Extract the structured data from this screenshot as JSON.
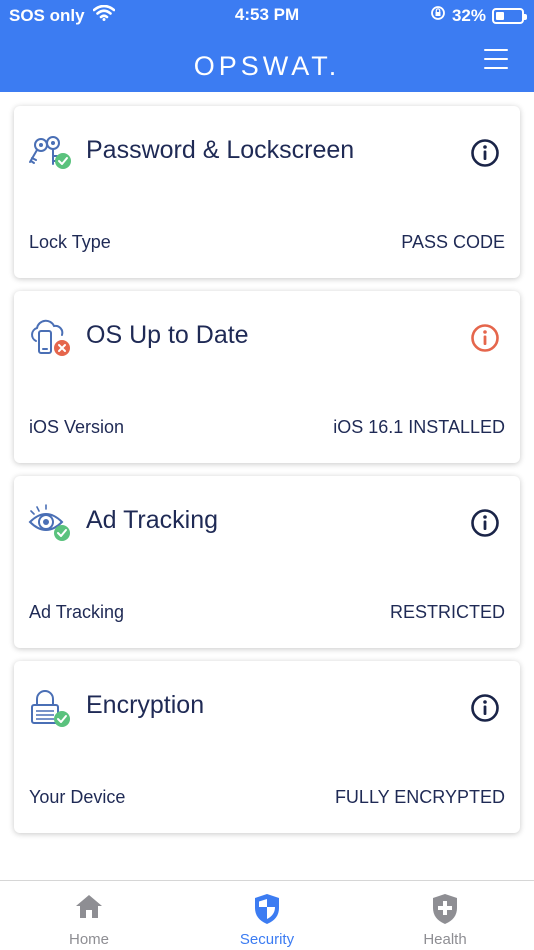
{
  "status_bar": {
    "carrier": "SOS only",
    "time": "4:53 PM",
    "battery_percent": "32%",
    "battery_level": 0.32,
    "icons": [
      "wifi-icon",
      "orientation-lock-icon",
      "battery-icon"
    ]
  },
  "nav": {
    "brand": "OPSWAT.",
    "menu_icon": "hamburger-menu-icon"
  },
  "colors": {
    "header": "#3c7cf2",
    "text": "#1f2a55",
    "ok": "#5ac27d",
    "error": "#e5664c",
    "warning_info": "#e5664c",
    "inactive_tab": "#8e8e93",
    "active_tab": "#3c7cf2"
  },
  "cards": [
    {
      "title": "Password & Lockscreen",
      "icon": "keys-icon",
      "status": "ok",
      "row_label": "Lock Type",
      "row_value": "PASS CODE"
    },
    {
      "title": "OS Up to Date",
      "icon": "cloud-phone-icon",
      "status": "error",
      "row_label": "iOS Version",
      "row_value": "iOS 16.1 INSTALLED"
    },
    {
      "title": "Ad Tracking",
      "icon": "eye-icon",
      "status": "ok",
      "row_label": "Ad Tracking",
      "row_value": "RESTRICTED"
    },
    {
      "title": "Encryption",
      "icon": "padlock-icon",
      "status": "ok",
      "row_label": "Your Device",
      "row_value": "FULLY ENCRYPTED"
    }
  ],
  "tabs": [
    {
      "label": "Home",
      "icon": "home-icon",
      "active": false
    },
    {
      "label": "Security",
      "icon": "shield-icon",
      "active": true
    },
    {
      "label": "Health",
      "icon": "health-shield-icon",
      "active": false
    }
  ]
}
